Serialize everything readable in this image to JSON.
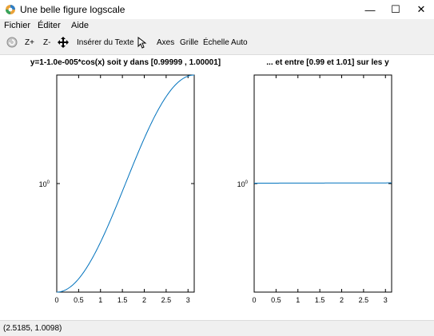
{
  "window": {
    "title": "Une belle figure logscale",
    "minimize": "—",
    "maximize": "☐",
    "close": "✕"
  },
  "menu": {
    "items": [
      "Fichier",
      "Éditer",
      "Aide"
    ]
  },
  "toolbar": {
    "zoom_in": "Z+",
    "zoom_out": "Z-",
    "insert_text": "Insérer du Texte",
    "axes": "Axes",
    "grid": "Grille",
    "autoscale": "Échelle Auto"
  },
  "chart_data": [
    {
      "type": "line",
      "title": "y=1-1.0e-005*cos(x) soit y dans [0.99999 , 1.00001]",
      "x_ticks": [
        "0",
        "0.5",
        "1",
        "1.5",
        "2",
        "2.5",
        "3"
      ],
      "y_tick": "10",
      "y_tick_exp": "0",
      "xlim": [
        0,
        3.1416
      ],
      "ylim": [
        0.99999,
        1.00001
      ],
      "yscale": "log",
      "series": [
        {
          "function": "1-1.0e-005*cos(x)",
          "color": "#0072bd"
        }
      ]
    },
    {
      "type": "line",
      "title": "... et entre [0.99 et 1.01] sur les y",
      "x_ticks": [
        "0",
        "0.5",
        "1",
        "1.5",
        "2",
        "2.5",
        "3"
      ],
      "y_tick": "10",
      "y_tick_exp": "0",
      "xlim": [
        0,
        3.1416
      ],
      "ylim": [
        0.99,
        1.01
      ],
      "yscale": "log",
      "series": [
        {
          "function": "1-1.0e-005*cos(x)",
          "color": "#0072bd"
        }
      ]
    }
  ],
  "status": {
    "coords": "(2.5185, 1.0098)"
  }
}
